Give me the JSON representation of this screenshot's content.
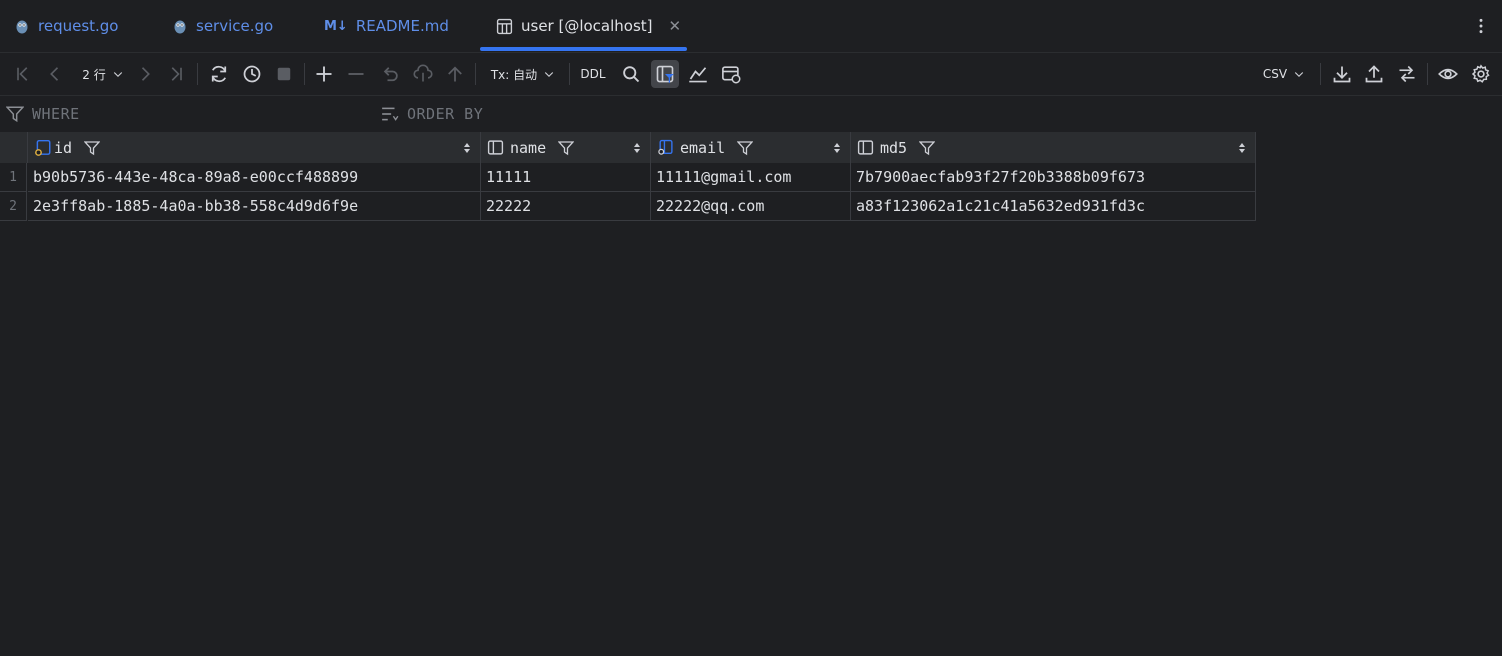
{
  "tabs": [
    {
      "label": "request.go",
      "icon": "go-gopher-icon"
    },
    {
      "label": "service.go",
      "icon": "go-gopher-icon"
    },
    {
      "label": "README.md",
      "icon": "markdown-icon",
      "badge": "M↓"
    },
    {
      "label": "user [@localhost]",
      "icon": "table-icon",
      "active": true
    }
  ],
  "toolbar": {
    "rows_label": "2 行",
    "tx_label": "Tx: 自动",
    "ddl_label": "DDL",
    "format_label": "CSV"
  },
  "filter": {
    "where_placeholder": "WHERE",
    "orderby_placeholder": "ORDER BY"
  },
  "table": {
    "columns": [
      {
        "name": "id",
        "icon": "primary-key-column-icon"
      },
      {
        "name": "name",
        "icon": "column-icon"
      },
      {
        "name": "email",
        "icon": "indexed-column-icon"
      },
      {
        "name": "md5",
        "icon": "column-icon"
      }
    ],
    "rows": [
      {
        "num": "1",
        "id": "b90b5736-443e-48ca-89a8-e00ccf488899",
        "name": "11111",
        "email": "11111@gmail.com",
        "md5": "7b7900aecfab93f27f20b3388b09f673"
      },
      {
        "num": "2",
        "id": "2e3ff8ab-1885-4a0a-bb38-558c4d9d6f9e",
        "name": "22222",
        "email": "22222@qq.com",
        "md5": "a83f123062a1c21c41a5632ed931fd3c"
      }
    ]
  },
  "colors": {
    "accent": "#3574f0",
    "background": "#1e1f22",
    "header": "#2b2d30"
  }
}
